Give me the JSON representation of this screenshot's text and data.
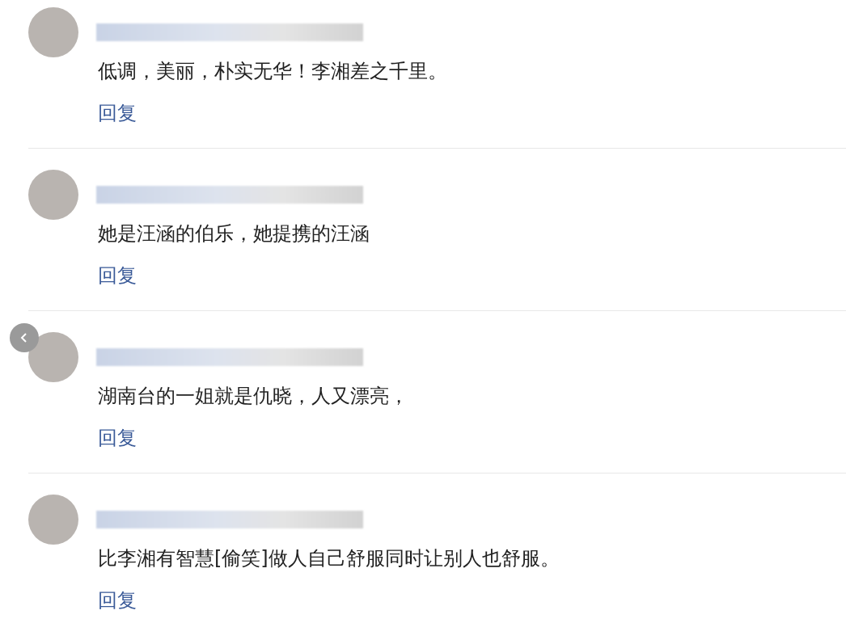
{
  "comments": [
    {
      "text": "低调，美丽，朴实无华！李湘差之千里。",
      "reply": "回复"
    },
    {
      "text": "她是汪涵的伯乐，她提携的汪涵",
      "reply": "回复"
    },
    {
      "text": "湖南台的一姐就是仇晓，人又漂亮，",
      "reply": "回复"
    },
    {
      "text": "比李湘有智慧[偷笑]做人自己舒服同时让别人也舒服。",
      "reply": "回复"
    }
  ]
}
